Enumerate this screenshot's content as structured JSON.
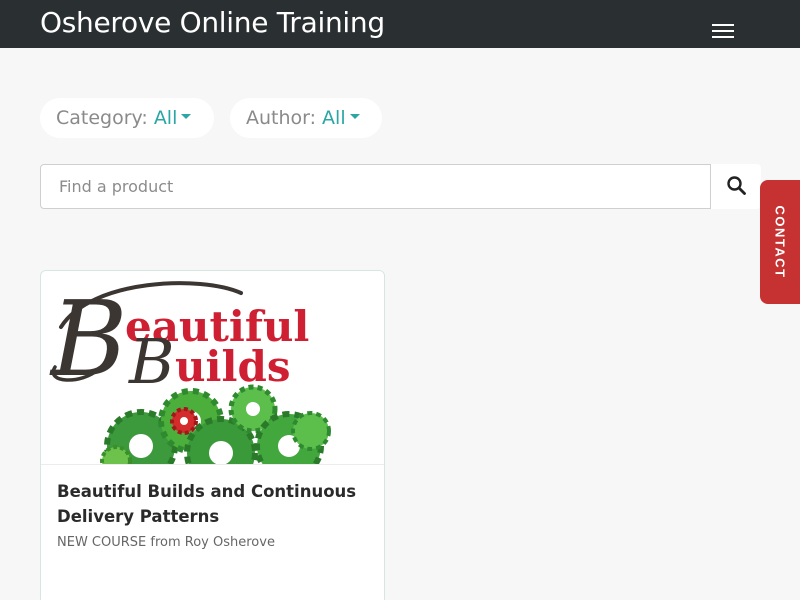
{
  "header": {
    "brand": "Osherove Online Training",
    "menu_icon": "hamburger-menu-icon"
  },
  "filters": {
    "category": {
      "label": "Category:",
      "value": "All"
    },
    "author": {
      "label": "Author:",
      "value": "All"
    }
  },
  "search": {
    "placeholder": "Find a product",
    "value": "",
    "button_icon": "search-icon"
  },
  "contact_tab": {
    "label": "CONTACT",
    "color": "#c63131"
  },
  "products": [
    {
      "image_text_beautiful": "Beautiful",
      "image_text_builds": "Builds",
      "title": "Beautiful Builds and Continuous Delivery Patterns",
      "subtitle": "NEW COURSE from Roy Osherove"
    }
  ],
  "colors": {
    "navbar": "#2a2f31",
    "accent": "#2aa6a5",
    "background": "#f7f7f7"
  }
}
